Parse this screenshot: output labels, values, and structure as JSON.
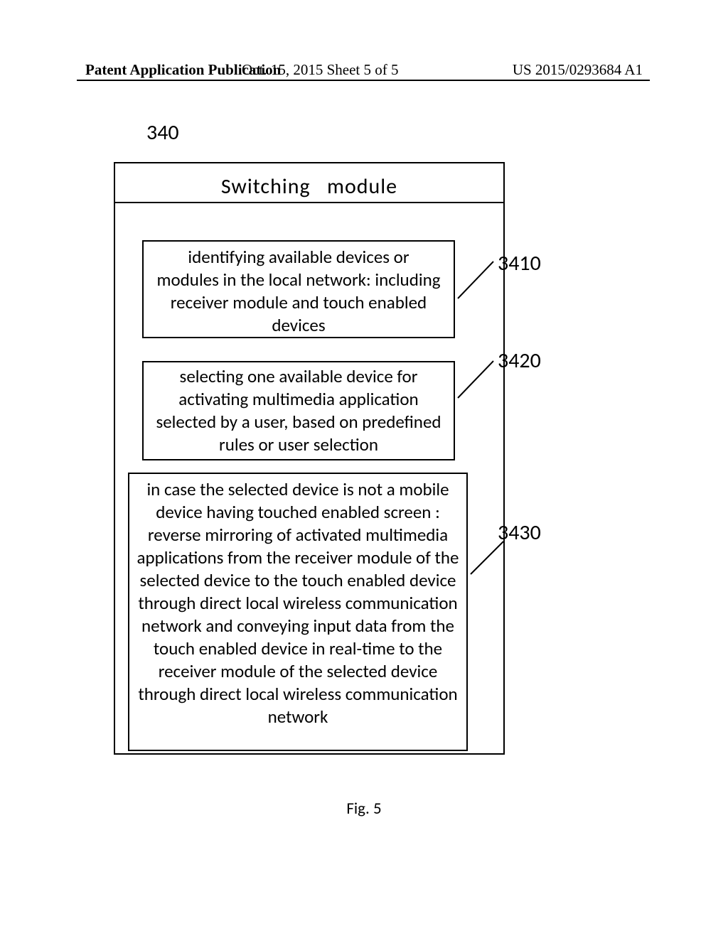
{
  "header": {
    "left": "Patent Application Publication",
    "mid": "Oct. 15, 2015  Sheet 5 of 5",
    "right": "US 2015/0293684 A1"
  },
  "labels": {
    "figref_main": "340",
    "module_title": "Switching   module",
    "ref1": "3410",
    "ref2": "3420",
    "ref3": "3430",
    "figcaption": "Fig. 5"
  },
  "boxes": {
    "b1": "identifying available devices or modules  in the local network: including   receiver module and touch enabled devices",
    "b2": "selecting one available device for activating multimedia application selected by a user, based on predefined rules or user  selection",
    "b3": "in case the selected device is not a mobile device having touched enabled screen : reverse mirroring of activated multimedia applications from the receiver  module of the selected device to the touch enabled device through direct local wireless communication network  and conveying  input data from the touch enabled device in real-time to the receiver module of the selected device through direct local wireless communication network"
  }
}
